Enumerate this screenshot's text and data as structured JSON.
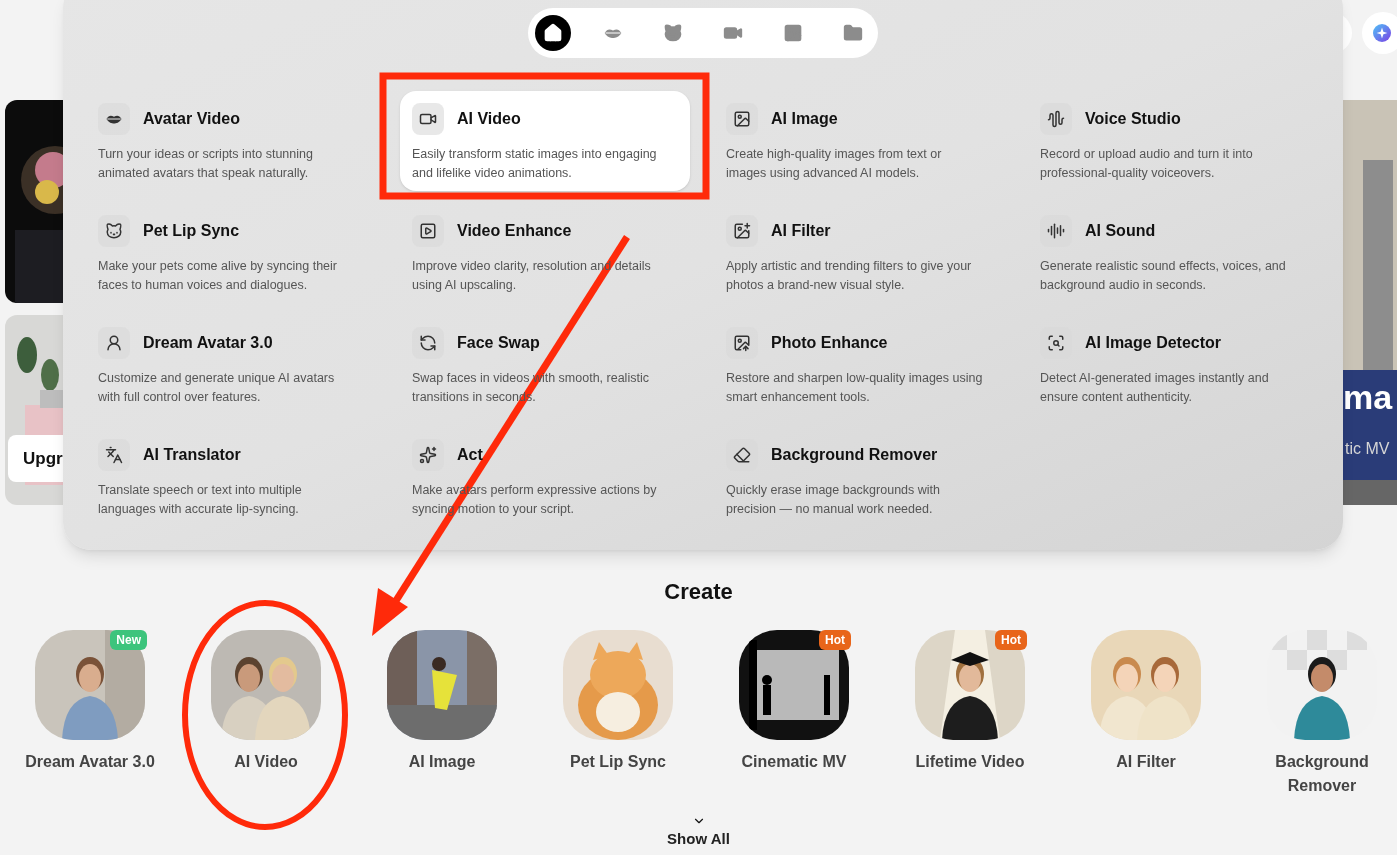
{
  "background": {
    "upgrade_button": "Upgr",
    "banner_title": "ma",
    "banner_subtitle": "tic MV"
  },
  "nav_tabs": [
    {
      "selected": true
    },
    {
      "selected": false
    },
    {
      "selected": false
    },
    {
      "selected": false
    },
    {
      "selected": false
    },
    {
      "selected": false
    }
  ],
  "tools": [
    {
      "title": "Avatar Video",
      "description": "Turn your ideas or scripts into stunning animated avatars that speak naturally.",
      "selected": false
    },
    {
      "title": "AI Video",
      "description": "Easily transform static images into engaging and lifelike video animations.",
      "selected": true
    },
    {
      "title": "AI Image",
      "description": "Create high-quality images from text or images using advanced AI models.",
      "selected": false
    },
    {
      "title": "Voice Studio",
      "description": "Record or upload audio and turn it into professional-quality voiceovers.",
      "selected": false
    },
    {
      "title": "Pet Lip Sync",
      "description": "Make your pets come alive by syncing their faces to human voices and dialogues.",
      "selected": false
    },
    {
      "title": "Video Enhance",
      "description": "Improve video clarity, resolution and details using AI upscaling.",
      "selected": false
    },
    {
      "title": "AI Filter",
      "description": "Apply artistic and trending filters to give your photos a brand-new visual style.",
      "selected": false
    },
    {
      "title": "AI Sound",
      "description": "Generate realistic sound effects, voices, and background audio in seconds.",
      "selected": false
    },
    {
      "title": "Dream Avatar 3.0",
      "description": "Customize and generate unique AI avatars with full control over features.",
      "selected": false
    },
    {
      "title": "Face Swap",
      "description": "Swap faces in videos with smooth, realistic transitions in seconds.",
      "selected": false
    },
    {
      "title": "Photo Enhance",
      "description": "Restore and sharpen low-quality images using smart enhancement tools.",
      "selected": false
    },
    {
      "title": "AI Image Detector",
      "description": "Detect AI-generated images instantly and ensure content authenticity.",
      "selected": false
    },
    {
      "title": "AI Translator",
      "description": "Translate speech or text into multiple languages with accurate lip-syncing.",
      "selected": false
    },
    {
      "title": "Act",
      "description": "Make avatars perform expressive actions by syncing motion to your script.",
      "selected": false
    },
    {
      "title": "Background Remover",
      "description": "Quickly erase image backgrounds with precision — no manual work needed.",
      "selected": false
    }
  ],
  "create": {
    "title": "Create",
    "items": [
      {
        "label": "Dream Avatar 3.0",
        "badge": {
          "text": "New",
          "color": "#3cc47c"
        }
      },
      {
        "label": "AI Video"
      },
      {
        "label": "AI Image"
      },
      {
        "label": "Pet Lip Sync"
      },
      {
        "label": "Cinematic MV",
        "badge": {
          "text": "Hot",
          "color": "#e8651a"
        }
      },
      {
        "label": "Lifetime Video",
        "badge": {
          "text": "Hot",
          "color": "#e8651a"
        }
      },
      {
        "label": "AI Filter"
      },
      {
        "label": "Background Remover"
      }
    ],
    "show_all": "Show All"
  }
}
